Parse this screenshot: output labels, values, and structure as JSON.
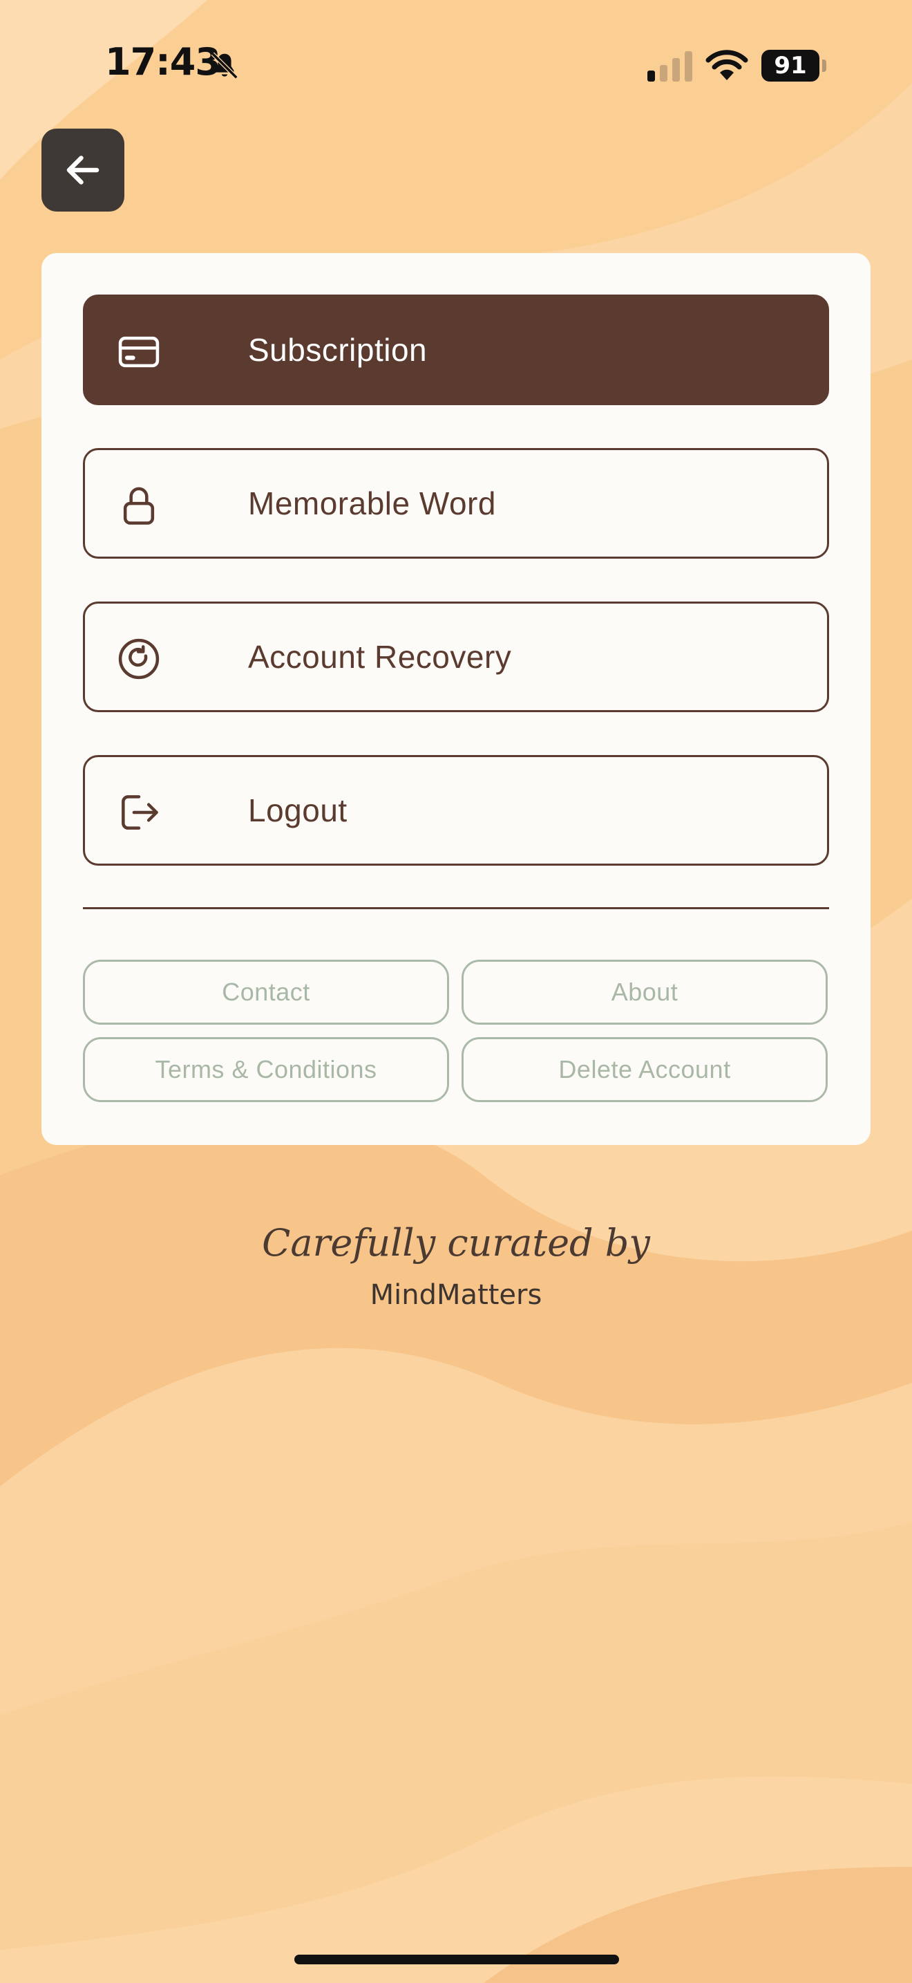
{
  "status_bar": {
    "time": "17:43",
    "battery_level": "91",
    "icons": [
      "bell-slash-icon",
      "cellular-signal-icon",
      "wifi-icon",
      "battery-icon"
    ]
  },
  "header": {
    "back_icon": "arrow-left-icon"
  },
  "menu": {
    "items": [
      {
        "label": "Subscription",
        "icon": "credit-card-icon",
        "active": true
      },
      {
        "label": "Memorable Word",
        "icon": "lock-icon",
        "active": false
      },
      {
        "label": "Account Recovery",
        "icon": "refresh-circle-icon",
        "active": false
      },
      {
        "label": "Logout",
        "icon": "logout-icon",
        "active": false
      }
    ]
  },
  "links": {
    "contact": "Contact",
    "about": "About",
    "terms": "Terms & Conditions",
    "delete_account": "Delete Account"
  },
  "footer": {
    "tagline": "Carefully curated by",
    "brand": "MindMatters"
  },
  "colors": {
    "background": "#fbd6a4",
    "background_wave": "#f6c48a",
    "card": "#fdfbf7",
    "primary": "#5b3b30",
    "secondary_outline": "#aab9a8",
    "back_button": "#3f3935"
  }
}
